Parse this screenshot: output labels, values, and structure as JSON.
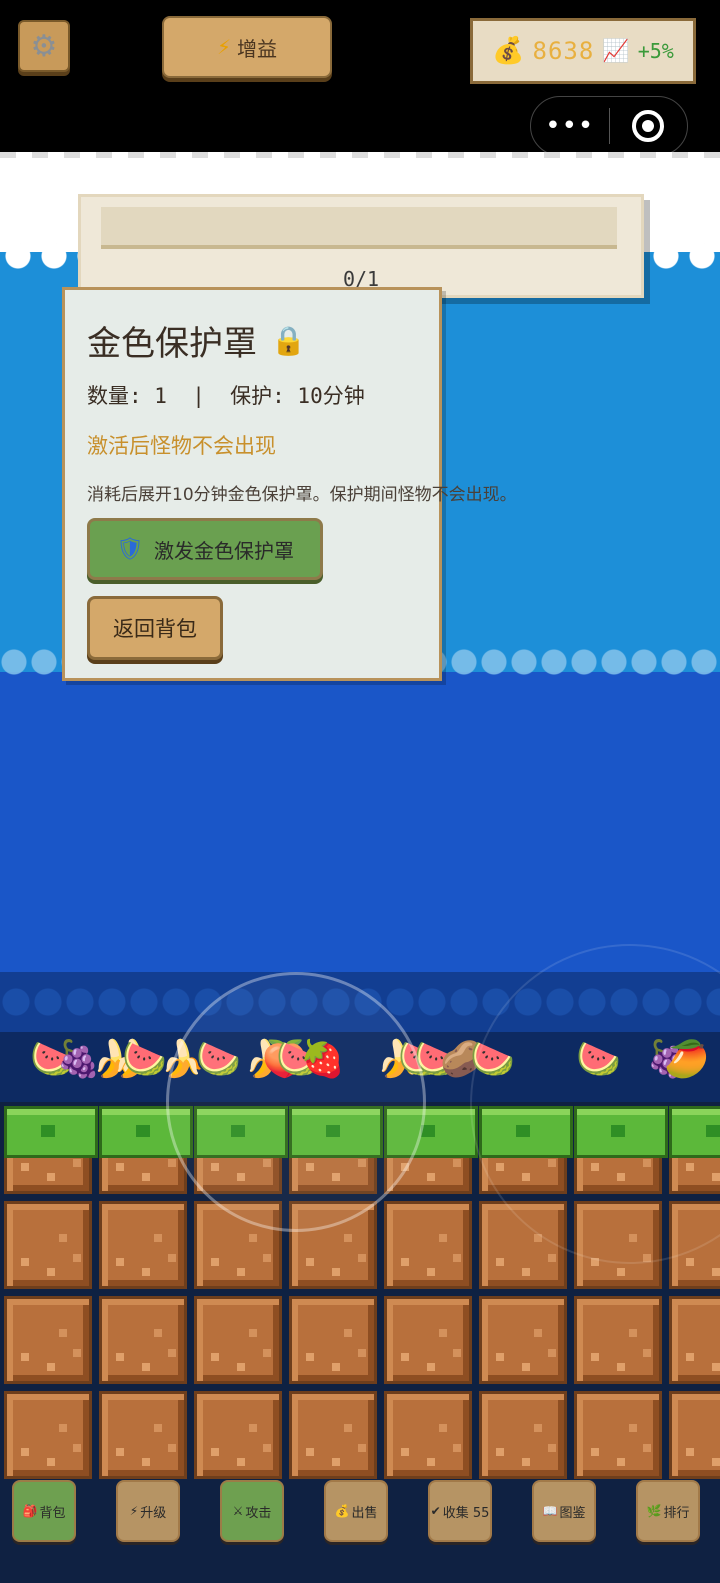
{
  "topbar": {
    "settings_icon": "gear-icon",
    "boost_label": "增益",
    "boost_icon": "lightning-icon",
    "money_icon": "money-bag-icon",
    "gold_amount": "8638",
    "trend_icon": "chart-up-icon",
    "income_rate": "+5%",
    "capsule_more": "•••",
    "capsule_close_icon": "target-icon"
  },
  "quest": {
    "progress": "0/1"
  },
  "item_modal": {
    "title": "金色保护罩",
    "lock_icon": "lock-icon",
    "meta": "数量: 1  |  保护: 10分钟",
    "effect": "激活后怪物不会出现",
    "description": "消耗后展开10分钟金色保护罩。保护期间怪物不会出现。",
    "activate_label": "激发金色保护罩",
    "activate_icon": "shield-icon",
    "back_label": "返回背包"
  },
  "fruits": [
    "🍉",
    "🍇",
    "🍌",
    "🍌",
    "🍉",
    "🍌",
    "🍉",
    "🍌",
    "🍑",
    "🍉",
    "🍓",
    "🍌",
    "🍉",
    "🍉",
    "🥔",
    "🍉",
    "🍉",
    "🍇",
    "🥭"
  ],
  "toolbar": [
    {
      "icon": "backpack-icon",
      "glyph": "🎒",
      "label": "背包",
      "style": "green"
    },
    {
      "icon": "lightning-icon",
      "glyph": "⚡",
      "label": "升级",
      "style": "tan"
    },
    {
      "icon": "swords-icon",
      "glyph": "⚔",
      "label": "攻击",
      "style": "green"
    },
    {
      "icon": "money-bag-icon",
      "glyph": "💰",
      "label": "出售",
      "style": "tan"
    },
    {
      "icon": "check-icon",
      "glyph": "✔",
      "label": "收集 55",
      "style": "tan"
    },
    {
      "icon": "book-icon",
      "glyph": "📖",
      "label": "图鉴",
      "style": "tan"
    },
    {
      "icon": "leaf-icon",
      "glyph": "🌿",
      "label": "排行",
      "style": "tan"
    }
  ],
  "colors": {
    "sky": "#1d8fd8",
    "deep_sky": "#1a56c8",
    "button_tan": "#d4a86a",
    "button_green": "#6aa050",
    "gold_text": "#e8b040",
    "effect_text": "#c8902c"
  }
}
